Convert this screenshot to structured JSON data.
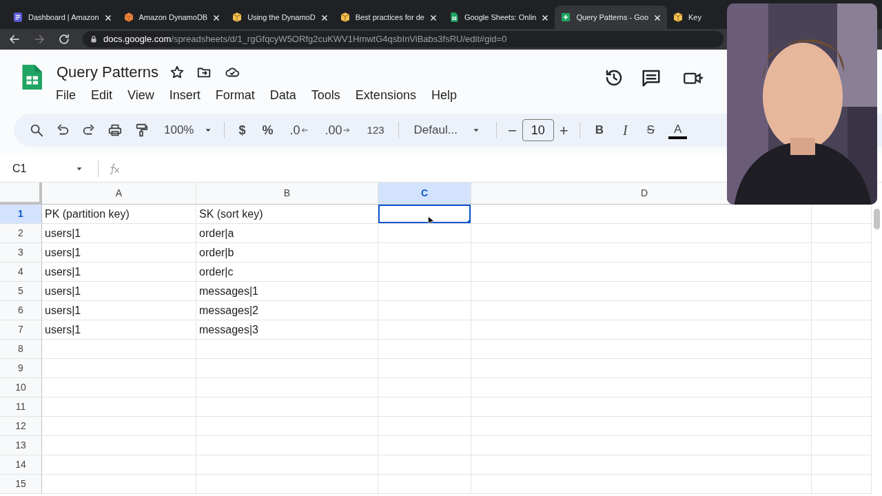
{
  "browser": {
    "tabs": [
      {
        "title": "Dashboard | Amazon",
        "kind": "document",
        "selected": false
      },
      {
        "title": "Amazon DynamoDB",
        "kind": "cube",
        "selected": false
      },
      {
        "title": "Using the DynamoD",
        "kind": "box",
        "selected": false
      },
      {
        "title": "Best practices for de",
        "kind": "box",
        "selected": false
      },
      {
        "title": "Google Sheets: Onlin",
        "kind": "sheet",
        "selected": false
      },
      {
        "title": "Query Patterns - Goo",
        "kind": "plus",
        "selected": true
      },
      {
        "title": "Key",
        "kind": "box",
        "selected": false
      }
    ],
    "url_host": "docs.google.com",
    "url_path": "/spreadsheets/d/1_rgGfqcyW5ORfg2cuKWV1HmwtG4qsbInViBabs3fsRU/edit#gid=0"
  },
  "doc": {
    "title": "Query Patterns",
    "menu": [
      "File",
      "Edit",
      "View",
      "Insert",
      "Format",
      "Data",
      "Tools",
      "Extensions",
      "Help"
    ]
  },
  "toolbar": {
    "zoom": "100%",
    "number_formats": [
      "$",
      "%",
      ".0",
      ".00",
      "123"
    ],
    "font": "Defaul...",
    "font_size": "10",
    "minus": "−",
    "plus": "+",
    "bold": "B",
    "italic": "I",
    "strike": "S",
    "text_color": "A"
  },
  "formula_bar": {
    "cell_ref": "C1"
  },
  "sheet": {
    "columns": [
      {
        "label": "A",
        "selected": false
      },
      {
        "label": "B",
        "selected": false
      },
      {
        "label": "C",
        "selected": true
      },
      {
        "label": "D",
        "selected": false
      }
    ],
    "rows": [
      {
        "number": "1",
        "selected": true,
        "cells": [
          "PK (partition key)",
          "SK (sort key)"
        ]
      },
      {
        "number": "2",
        "selected": false,
        "cells": [
          "users|1",
          "order|a"
        ]
      },
      {
        "number": "3",
        "selected": false,
        "cells": [
          "users|1",
          "order|b"
        ]
      },
      {
        "number": "4",
        "selected": false,
        "cells": [
          "users|1",
          "order|c"
        ]
      },
      {
        "number": "5",
        "selected": false,
        "cells": [
          "users|1",
          "messages|1"
        ]
      },
      {
        "number": "6",
        "selected": false,
        "cells": [
          "users|1",
          "messages|2"
        ]
      },
      {
        "number": "7",
        "selected": false,
        "cells": [
          "users|1",
          "messages|3"
        ]
      },
      {
        "number": "8",
        "selected": false
      },
      {
        "number": "9",
        "selected": false
      },
      {
        "number": "10",
        "selected": false
      },
      {
        "number": "11",
        "selected": false
      },
      {
        "number": "12",
        "selected": false
      },
      {
        "number": "13",
        "selected": false
      },
      {
        "number": "14",
        "selected": false
      },
      {
        "number": "15",
        "selected": false
      }
    ]
  }
}
